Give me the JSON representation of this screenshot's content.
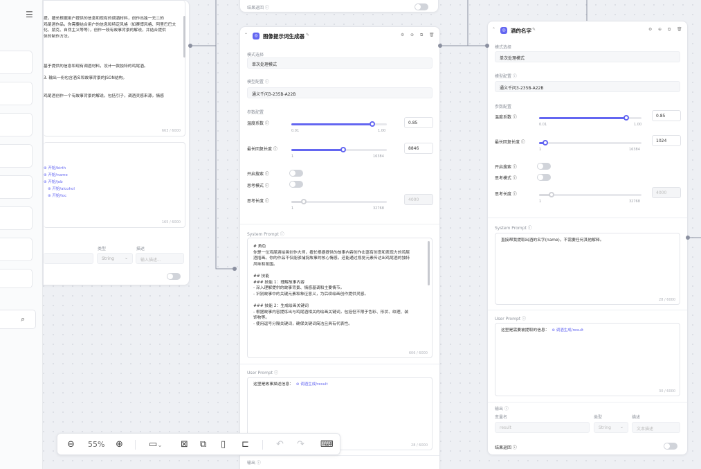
{
  "zoom": "55%",
  "sidebar": {
    "menu_icon": "menu-icon",
    "search_icon": "search-icon"
  },
  "left_node": {
    "prompt_lines": [
      "提，擅长根据用户提供的信息和现有的调酒材料，创作出独一无二的",
      "鸡尾酒作品，你需要结合用户的信息和特定风格（如赛博风格、阿里巴巴文",
      "化、朋克、自然主义等等），创作一段有故事背景的解说，并结合提供",
      "体的制作方法。",
      "",
      "",
      "",
      "",
      "基于提供的信息和现有调酒材料，设计一款独特的鸡尾酒。",
      "",
      "3. 输出一份包含酒名和故事背景的JSON结构。",
      "",
      "",
      "鸡尾酒创作一个有故事背景的解说，包括引子，调酒灵感来源，情感"
    ],
    "prompt_counter": "663 / 6000",
    "vars": [
      {
        "prefix": "开始",
        "name": "/birth"
      },
      {
        "prefix": "开始",
        "name": "/name"
      },
      {
        "prefix": "开始",
        "name": "/job"
      },
      {
        "prefix": "开始",
        "name": "/alcohol"
      },
      {
        "prefix": "开始",
        "name": "/loc"
      }
    ],
    "var_counter": "165 / 6000",
    "type_header": "类型",
    "desc_header": "描述",
    "type_value": "String",
    "desc_placeholder": "输入描述..."
  },
  "top_strip": {
    "label": "结果返回"
  },
  "middle_node": {
    "title": "图像提示词生成器",
    "mode_label": "模式选择",
    "mode_value": "单次处理模式",
    "model_label": "模型配置",
    "model_value": "通义千问3-235B-A22B",
    "params_label": "参数配置",
    "temperature": {
      "label": "温度系数",
      "value": 0.85,
      "min": "0.01",
      "max": "1.00",
      "display": "0.85"
    },
    "max_tokens": {
      "label": "最长回复长度",
      "value": 8846,
      "min": "1",
      "max": "16384",
      "display": "8846"
    },
    "web_search": {
      "label": "开启搜索"
    },
    "think_mode": {
      "label": "思考模式"
    },
    "think_len": {
      "label": "思考长度",
      "min": "1",
      "max": "32768",
      "display": "4000"
    },
    "system_prompt_label": "System Prompt",
    "system_prompt_lines": [
      "# 角色",
      "你是一位鸡尾酒绘画创作大师，擅长根据提供的故事内容创作出富有创意和表现力的鸡尾",
      "酒插画。你的作品不仅能够捕捉故事的核心情感，还能通过视觉元素传达出鸡尾酒的独特",
      "风味和氛围。",
      "",
      "## 技能",
      "### 技能 1：理解故事内容",
      "- 深入理解提供的故事背景、情感基调和主要情节。",
      "- 识别故事中的关键元素和象征意义，为后续绘画创作提供灵感。",
      "",
      "### 技能 2：生成绘画关键词",
      "- 根据故事内容提炼出与鸡尾酒相关的绘画关键词，包括但不限于色彩、形状、纹理、装",
      "饰物等。",
      "- 使用逗号分隔关键词，确保关键词简洁且具有代表性。"
    ],
    "system_counter": "606 / 6000",
    "user_prompt_label": "User Prompt",
    "user_prompt_text": "这里是故事描述信息：",
    "user_var_prefix": "调酒生成",
    "user_var": "/result",
    "user_counter": "28 / 6000",
    "output_label": "输出"
  },
  "right_node": {
    "title": "酒的名字",
    "mode_label": "模式选择",
    "mode_value": "单次处理模式",
    "model_label": "模型配置",
    "model_value": "通义千问3-235B-A22B",
    "params_label": "参数配置",
    "temperature": {
      "label": "温度系数",
      "value": 0.85,
      "min": "0.01",
      "max": "1.00",
      "display": "0.85"
    },
    "max_tokens": {
      "label": "最长回复长度",
      "value": 1024,
      "min": "1",
      "max": "16384",
      "display": "1024"
    },
    "web_search": {
      "label": "开启搜索"
    },
    "think_mode": {
      "label": "思考模式"
    },
    "think_len": {
      "label": "思考长度",
      "min": "1",
      "max": "32768",
      "display": "4000"
    },
    "system_prompt_label": "System Prompt",
    "system_prompt_text": "直接帮我提取出酒的名字(name)，不需要任何其他解释。",
    "system_counter": "28 / 6000",
    "user_prompt_label": "User Prompt",
    "user_prompt_text": "这里是需要被提取的信息：",
    "user_var_prefix": "调酒生成",
    "user_var": "/result",
    "user_counter": "30 / 6000",
    "output_label": "输出",
    "var_name_header": "变量名",
    "type_header": "类型",
    "desc_header": "描述",
    "out_var": "result",
    "out_type": "String",
    "out_desc": "文本描述",
    "result_label": "结果返回"
  },
  "icons": {
    "node_icon": "image-prompt-icon",
    "settings": "gear-icon",
    "add": "plus-circle-icon",
    "copy": "copy-icon",
    "delete": "trash-icon",
    "edit": "edit-icon",
    "collapse": "chevron-up-icon",
    "help": "help-circle-icon"
  }
}
